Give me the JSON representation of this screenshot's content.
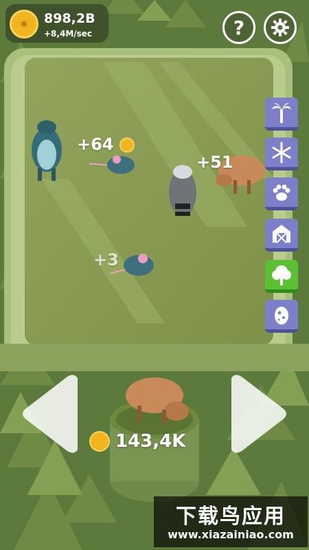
{
  "hud": {
    "money_total": "898,2B",
    "money_rate": "+8,4M/sec",
    "coin_icon": "coin-icon",
    "help_label": "?",
    "settings_icon": "gear-icon"
  },
  "biome_buttons": [
    {
      "icon": "palm-tree-icon",
      "active": false
    },
    {
      "icon": "snowflake-icon",
      "active": false
    },
    {
      "icon": "paw-print-icon",
      "active": false
    },
    {
      "icon": "barn-icon",
      "active": false
    },
    {
      "icon": "tree-icon",
      "active": true
    },
    {
      "icon": "egg-icon",
      "active": false
    }
  ],
  "floating_rewards": [
    {
      "text": "+64"
    },
    {
      "text": "+51"
    },
    {
      "text": "+3"
    }
  ],
  "animals": [
    "otter",
    "mouse",
    "raccoon",
    "boar",
    "mouse"
  ],
  "shop": {
    "featured_animal": "boar",
    "price": "143,4K"
  },
  "watermark": {
    "title": "下载鸟应用",
    "url": "www.xiazainiao.com"
  },
  "colors": {
    "enclosure_floor": "#8a9a55",
    "enclosure_border": "#a6bf79",
    "biome_button": "#7c80c8",
    "biome_button_active": "#5bc033",
    "coin": "#f2b51d"
  }
}
